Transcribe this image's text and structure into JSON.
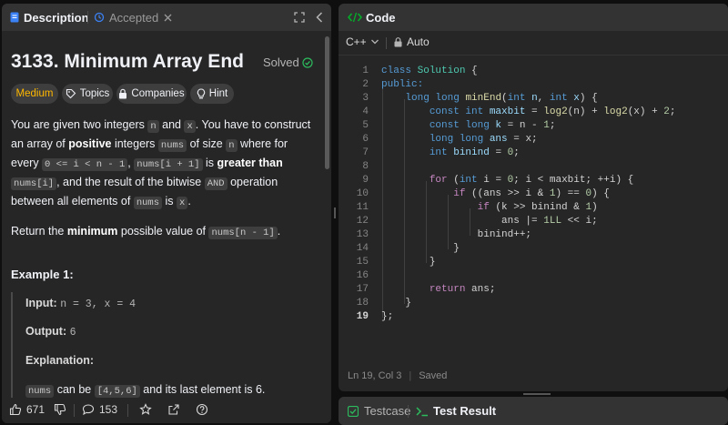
{
  "left_panel": {
    "tabs": {
      "description": "Description",
      "accepted": "Accepted"
    },
    "problem": {
      "title": "3133. Minimum Array End",
      "status": "Solved",
      "difficulty": "Medium",
      "chips": {
        "topics": "Topics",
        "companies": "Companies",
        "hint": "Hint"
      }
    },
    "description": {
      "p1": {
        "t1": "You are given two integers ",
        "c1": "n",
        "t2": " and ",
        "c2": "x",
        "t3": ". You have to construct an array of ",
        "b1": "positive",
        "t4": " integers ",
        "c3": "nums",
        "t5": " of size ",
        "c4": "n",
        "t6": " where for every ",
        "c5": "0 <= i < n - 1",
        "t7": ", ",
        "c6": "nums[i + 1]",
        "t8": " is ",
        "b2": "greater than",
        "t9": " ",
        "c7": "nums[i]",
        "t10": ", and the result of the bitwise ",
        "c8": "AND",
        "t11": " operation between all elements of ",
        "c9": "nums",
        "t12": " is ",
        "c10": "x",
        "t13": "."
      },
      "p2": {
        "t1": "Return the ",
        "b1": "minimum",
        "t2": " possible value of ",
        "c1": "nums[n - 1]",
        "t3": "."
      }
    },
    "example": {
      "heading": "Example 1:",
      "input_label": "Input:",
      "input_value": "n = 3, x = 4",
      "output_label": "Output:",
      "output_value": "6",
      "explanation_label": "Explanation:",
      "explanation": {
        "c1": "nums",
        "t1": " can be ",
        "c2": "[4,5,6]",
        "t2": " and its last element is 6."
      }
    },
    "footer": {
      "likes": "671",
      "comments": "153"
    }
  },
  "editor": {
    "tab_label": "Code",
    "language": "C++",
    "mode": "Auto",
    "line_numbers": [
      "1",
      "2",
      "3",
      "4",
      "5",
      "6",
      "7",
      "8",
      "9",
      "10",
      "11",
      "12",
      "13",
      "14",
      "15",
      "16",
      "17",
      "18",
      "19"
    ],
    "code": {
      "l1_kw": "class",
      "l1_ty": "Solution",
      "l1_p": " {",
      "l2_kw": "public:",
      "l3_kw": "long long",
      "l3_fn": "minEnd",
      "l3_p1": "(",
      "l3_kw2": "int",
      "l3_v1": " n",
      "l3_p2": ", ",
      "l3_kw3": "int",
      "l3_v2": " x",
      "l3_p3": ") {",
      "l4_kw": "const int",
      "l4_v": " maxbit",
      "l4_p1": " = ",
      "l4_fn1": "log2",
      "l4_p2": "(n) + ",
      "l4_fn2": "log2",
      "l4_p3": "(x) + ",
      "l4_n": "2",
      "l4_p4": ";",
      "l5_kw": "const long",
      "l5_v": " k",
      "l5_p1": " = n - ",
      "l5_n": "1",
      "l5_p2": ";",
      "l6_kw": "long long",
      "l6_v": " ans",
      "l6_p": " = x;",
      "l7_kw": "int",
      "l7_v": " binind",
      "l7_p1": " = ",
      "l7_n": "0",
      "l7_p2": ";",
      "l9_cf": "for",
      "l9_p1": " (",
      "l9_kw": "int",
      "l9_p2": " i = ",
      "l9_n": "0",
      "l9_p3": "; i < maxbit; ++i) {",
      "l10_cf": "if",
      "l10_p1": " ((ans >> i & ",
      "l10_n1": "1",
      "l10_p2": ") == ",
      "l10_n2": "0",
      "l10_p3": ") {",
      "l11_cf": "if",
      "l11_p1": " (k >> binind & ",
      "l11_n": "1",
      "l11_p2": ")",
      "l12_p1": "ans |= ",
      "l12_n": "1LL",
      "l12_p2": " << i;",
      "l13_p": "binind++;",
      "l14_p": "}",
      "l15_p": "}",
      "l17_cf": "return",
      "l17_p": " ans;",
      "l18_p": "}",
      "l19_p": "};"
    },
    "status": {
      "position": "Ln 19, Col 3",
      "saved": "Saved"
    }
  },
  "bottom_panel": {
    "testcase": "Testcase",
    "test_result": "Test Result"
  },
  "colors": {
    "accent_green": "#2cbb5d",
    "medium": "#ffb800",
    "code_icon": "#02b128"
  }
}
